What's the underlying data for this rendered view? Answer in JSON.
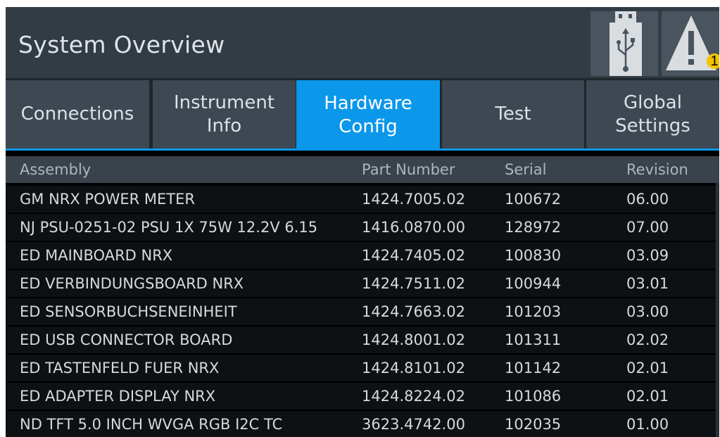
{
  "header": {
    "title": "System Overview",
    "usb_icon": "usb-icon",
    "warning_icon": "warning-icon",
    "warning_count": "1"
  },
  "tabs": [
    {
      "label_line1": "Connections",
      "label_line2": "",
      "active": false
    },
    {
      "label_line1": "Instrument",
      "label_line2": "Info",
      "active": false
    },
    {
      "label_line1": "Hardware",
      "label_line2": "Config",
      "active": true
    },
    {
      "label_line1": "Test",
      "label_line2": "",
      "active": false
    },
    {
      "label_line1": "Global",
      "label_line2": "Settings",
      "active": false
    }
  ],
  "table": {
    "columns": [
      "Assembly",
      "Part Number",
      "Serial",
      "Revision"
    ],
    "rows": [
      [
        "GM NRX POWER METER",
        "1424.7005.02",
        "100672",
        "06.00"
      ],
      [
        "NJ PSU-0251-02 PSU 1X 75W 12.2V 6.15",
        "1416.0870.00",
        "128972",
        "07.00"
      ],
      [
        "ED MAINBOARD NRX",
        "1424.7405.02",
        "100830",
        "03.09"
      ],
      [
        "ED VERBINDUNGSBOARD NRX",
        "1424.7511.02",
        "100944",
        "03.01"
      ],
      [
        "ED SENSORBUCHSENEINHEIT",
        "1424.7663.02",
        "101203",
        "03.00"
      ],
      [
        "ED USB CONNECTOR BOARD",
        "1424.8001.02",
        "101311",
        "02.02"
      ],
      [
        "ED TASTENFELD FUER NRX",
        "1424.8101.02",
        "101142",
        "02.01"
      ],
      [
        "ED ADAPTER DISPLAY NRX",
        "1424.8224.02",
        "101086",
        "02.01"
      ],
      [
        "ND TFT 5.0 INCH WVGA RGB I2C TC",
        "3623.4742.00",
        "102035",
        "01.00"
      ]
    ]
  },
  "colors": {
    "accent": "#0b97ea",
    "header_bg": "#323c45",
    "tab_bg": "#3d4852",
    "warning_badge": "#f5c400"
  }
}
